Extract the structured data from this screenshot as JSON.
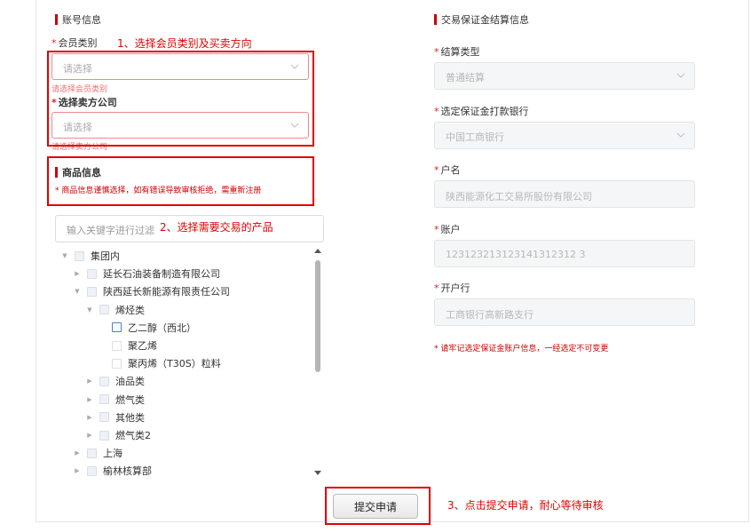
{
  "account_section": {
    "title": "账号信息",
    "member_type": {
      "label": "会员类别",
      "placeholder": "请选择",
      "error": "请选择会员类别"
    },
    "seller_company": {
      "label": "选择卖方公司",
      "placeholder": "请选择",
      "error": "请选择卖方公司"
    }
  },
  "product_section": {
    "title": "商品信息",
    "notice": "* 商品信息谨慎选择，如有错误导致审核拒绝，需重新注册",
    "search_placeholder": "输入关键字进行过滤",
    "tree": [
      {
        "label": "集团内",
        "level": 0,
        "arrow": "down",
        "cb": "gray"
      },
      {
        "label": "延长石油装备制造有限公司",
        "level": 1,
        "arrow": "right",
        "cb": "gray"
      },
      {
        "label": "陕西延长新能源有限责任公司",
        "level": 1,
        "arrow": "down",
        "cb": "gray"
      },
      {
        "label": "烯烃类",
        "level": 2,
        "arrow": "down",
        "cb": "gray"
      },
      {
        "label": "乙二醇（西北）",
        "level": 3,
        "arrow": "",
        "cb": "focus"
      },
      {
        "label": "聚乙烯",
        "level": 3,
        "arrow": "",
        "cb": "white"
      },
      {
        "label": "聚丙烯（T30S）粒料",
        "level": 3,
        "arrow": "",
        "cb": "white"
      },
      {
        "label": "油品类",
        "level": 2,
        "arrow": "right",
        "cb": "gray"
      },
      {
        "label": "燃气类",
        "level": 2,
        "arrow": "right",
        "cb": "gray"
      },
      {
        "label": "其他类",
        "level": 2,
        "arrow": "right",
        "cb": "gray"
      },
      {
        "label": "燃气类2",
        "level": 2,
        "arrow": "right",
        "cb": "gray"
      },
      {
        "label": "上海",
        "level": 1,
        "arrow": "right",
        "cb": "gray"
      },
      {
        "label": "榆林核算部",
        "level": 1,
        "arrow": "right",
        "cb": "gray"
      }
    ]
  },
  "deposit_section": {
    "title": "交易保证金结算信息",
    "settlement_type": {
      "label": "结算类型",
      "value": "普通结算"
    },
    "bank": {
      "label": "选定保证金打款银行",
      "value": "中国工商银行"
    },
    "account_name": {
      "label": "户名",
      "value": "陕西能源化工交易所股份有限公司"
    },
    "account_no": {
      "label": "账户",
      "value": "123123213123141312312 3"
    },
    "open_bank": {
      "label": "开户行",
      "value": "工商银行高新路支行"
    },
    "notice": "* 请牢记选定保证金账户信息，一经选定不可变更"
  },
  "submit_label": "提交申请",
  "annotations": {
    "step1": "1、选择会员类别及买卖方向",
    "step2": "2、选择需要交易的产品",
    "step3": "3、点击提交申请，耐心等待审核"
  },
  "colors": {
    "accent": "#cc0000",
    "annotation": "#e00000",
    "error": "#f07070"
  }
}
